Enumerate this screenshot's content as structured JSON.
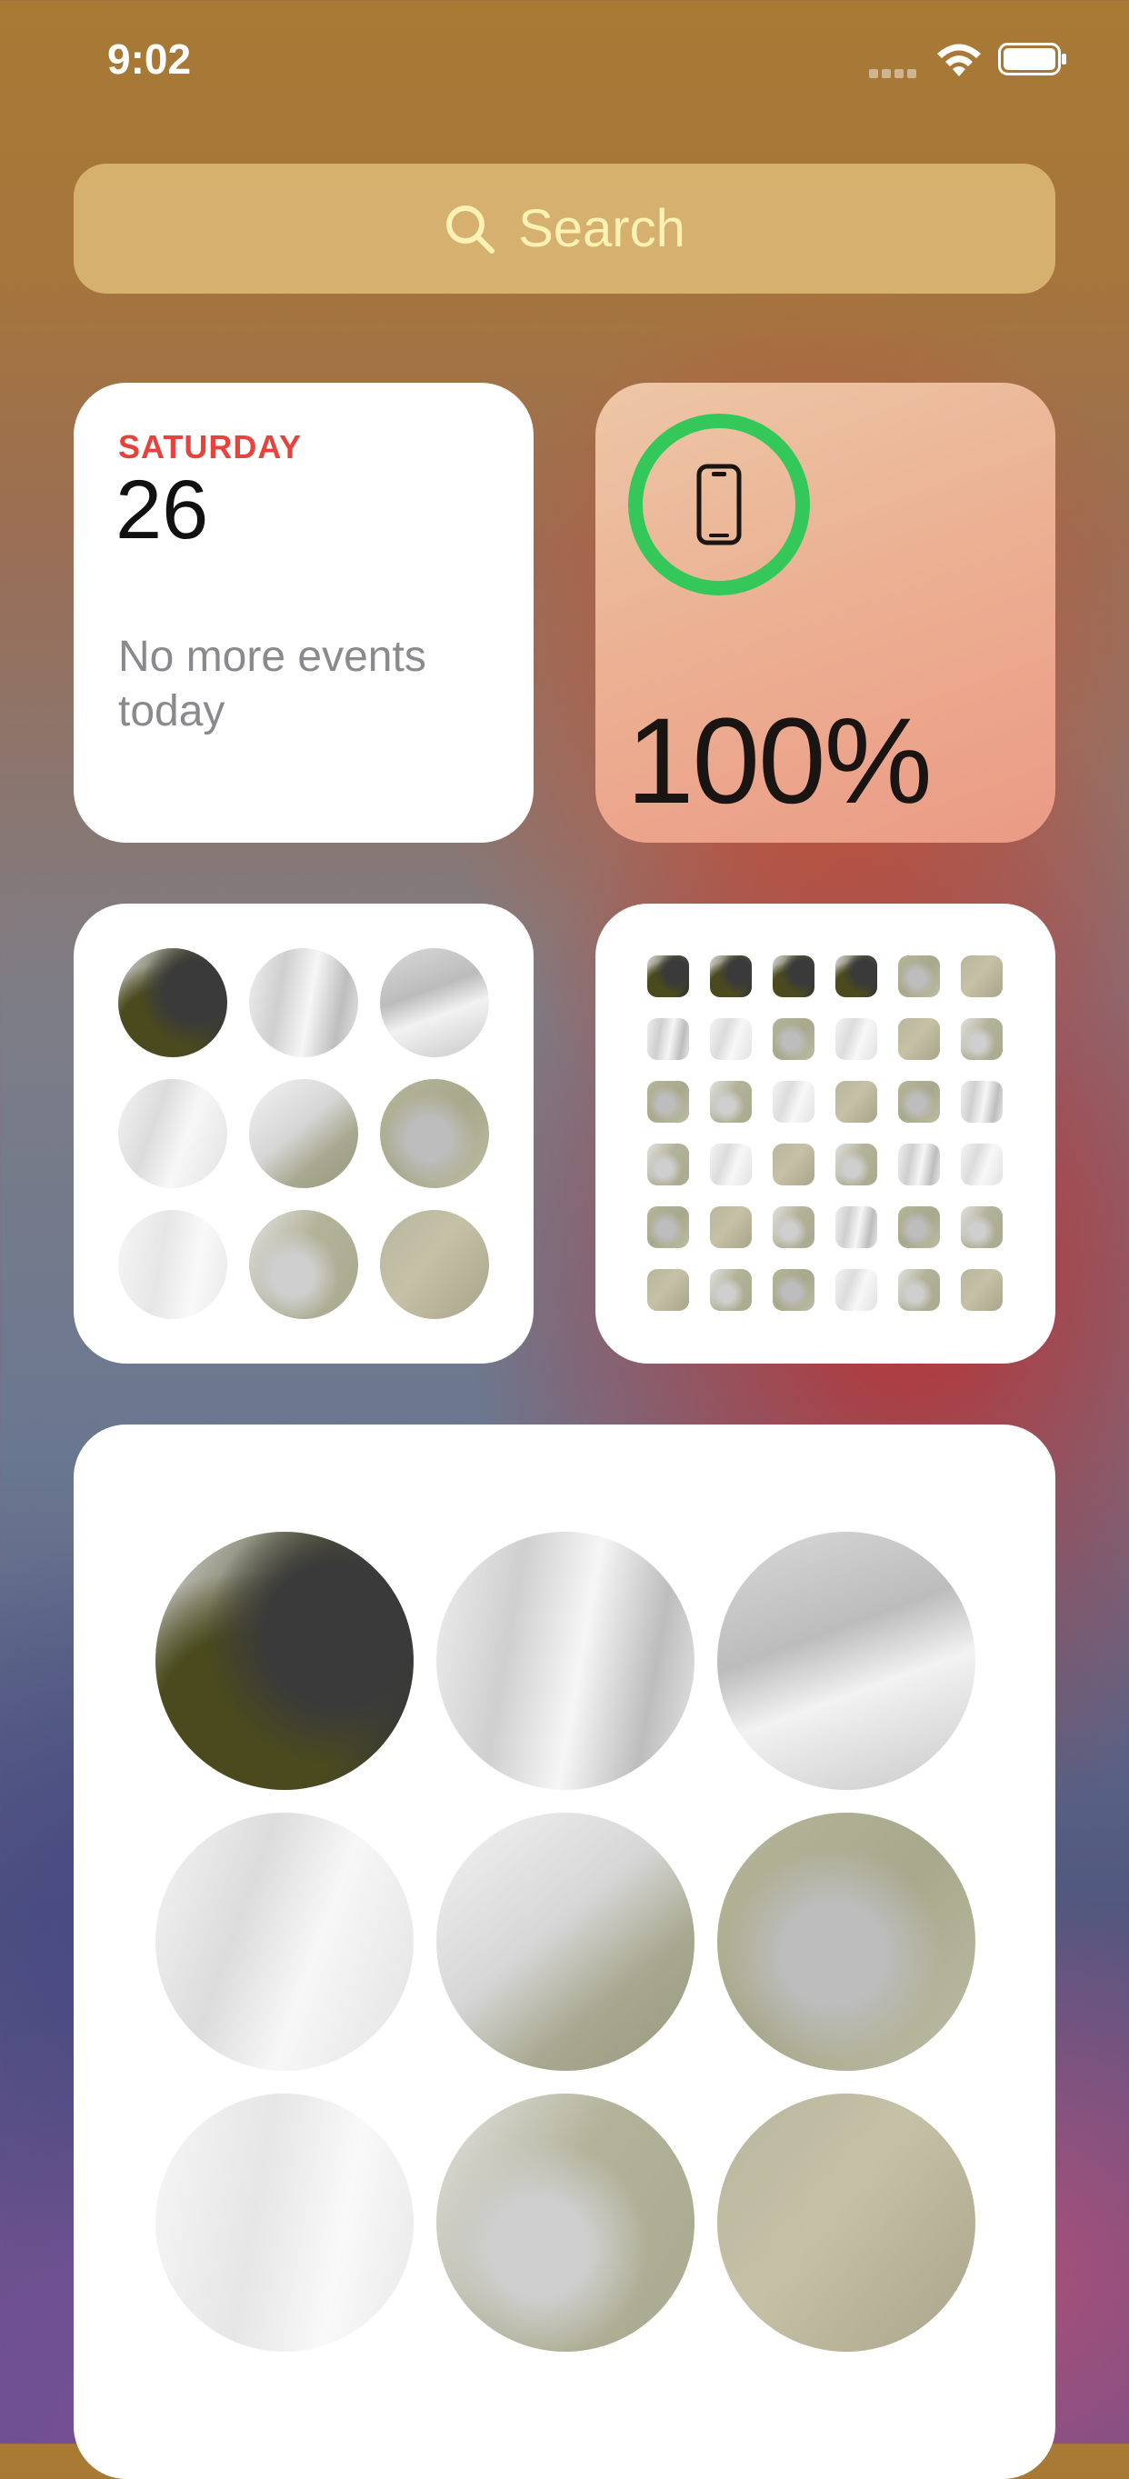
{
  "status_bar": {
    "time": "9:02"
  },
  "search": {
    "label": "Search"
  },
  "calendar_widget": {
    "day": "SATURDAY",
    "date": "26",
    "note": "No more events today"
  },
  "battery_widget": {
    "percent_label": "100%",
    "level": 1.0,
    "ring_color": "#34c759"
  },
  "photo_grid_small": {
    "tiles": [
      "photo-1",
      "photo-2",
      "photo-3",
      "photo-4",
      "photo-5",
      "photo-6",
      "photo-7",
      "photo-8",
      "photo-9"
    ]
  },
  "photo_grid_large": {
    "tiles": [
      "photo-1",
      "photo-2",
      "photo-3",
      "photo-4",
      "photo-5",
      "photo-6",
      "photo-7",
      "photo-8",
      "photo-9"
    ]
  },
  "colors": {
    "accent_red": "#e8423c",
    "battery_green": "#34c759",
    "search_text": "#fdf1b4"
  }
}
